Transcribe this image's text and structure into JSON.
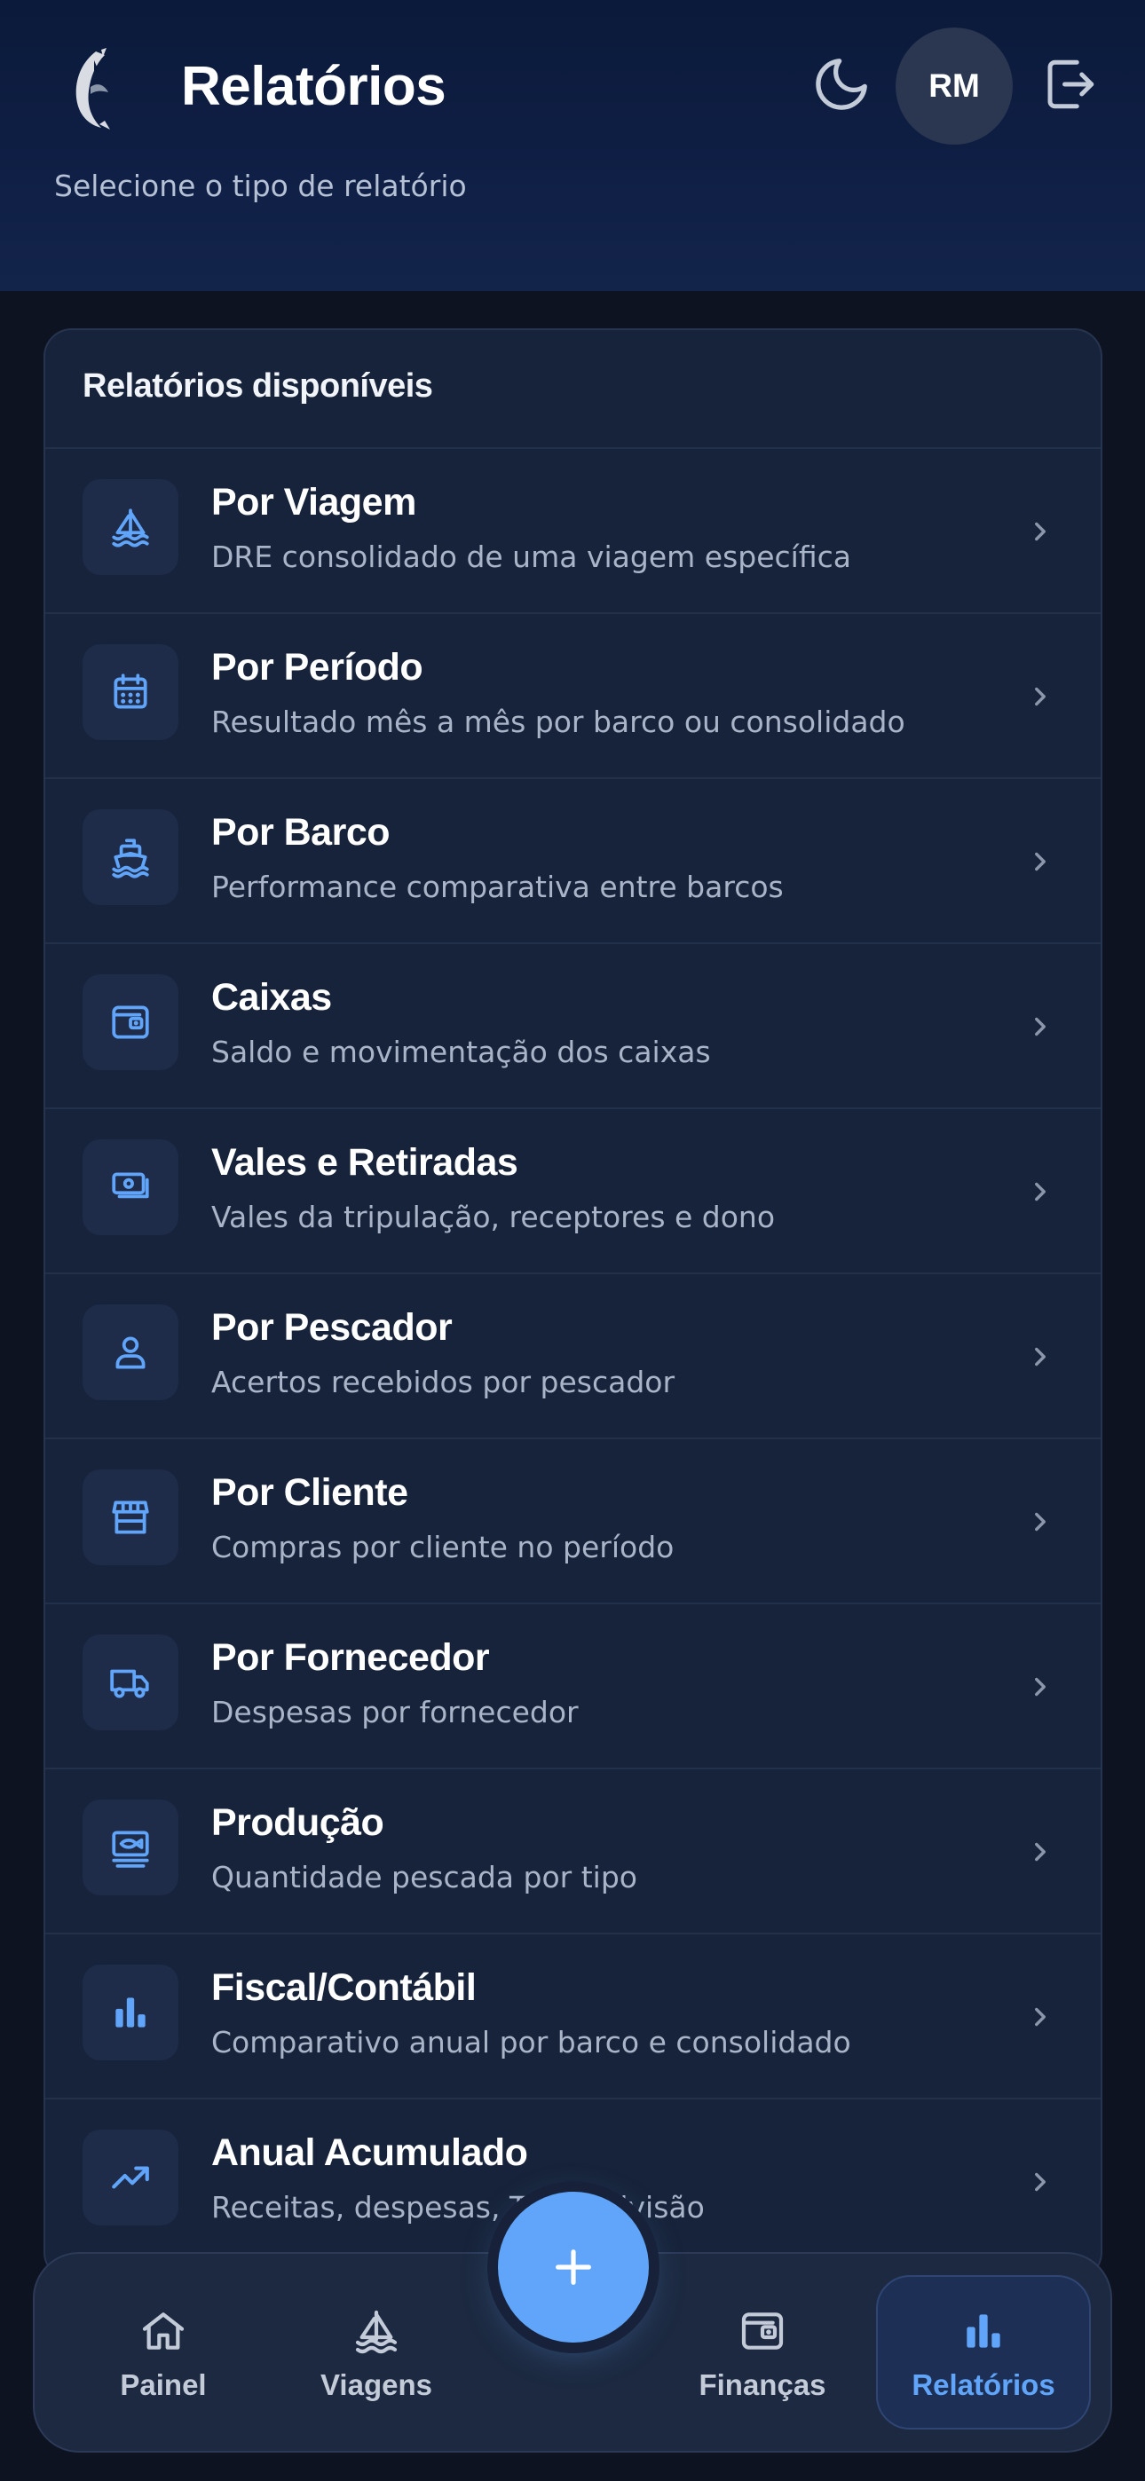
{
  "header": {
    "title": "Relatórios",
    "subtitle": "Selecione o tipo de relatório",
    "avatar_initials": "RM"
  },
  "card": {
    "title": "Relatórios disponíveis",
    "items": [
      {
        "title": "Por Viagem",
        "description": "DRE consolidado de uma viagem específica",
        "icon": "sailboat-icon"
      },
      {
        "title": "Por Período",
        "description": "Resultado mês a mês por barco ou consolidado",
        "icon": "calendar-icon"
      },
      {
        "title": "Por Barco",
        "description": "Performance comparativa entre barcos",
        "icon": "ship-icon"
      },
      {
        "title": "Caixas",
        "description": "Saldo e movimentação dos caixas",
        "icon": "wallet-icon"
      },
      {
        "title": "Vales e Retiradas",
        "description": "Vales da tripulação, receptores e dono",
        "icon": "banknotes-icon"
      },
      {
        "title": "Por Pescador",
        "description": "Acertos recebidos por pescador",
        "icon": "user-icon"
      },
      {
        "title": "Por Cliente",
        "description": "Compras por cliente no período",
        "icon": "store-icon"
      },
      {
        "title": "Por Fornecedor",
        "description": "Despesas por fornecedor",
        "icon": "truck-icon"
      },
      {
        "title": "Produção",
        "description": "Quantidade pescada por tipo",
        "icon": "fish-icon"
      },
      {
        "title": "Fiscal/Contábil",
        "description": "Comparativo anual por barco e consolidado",
        "icon": "bar-chart-icon"
      },
      {
        "title": "Anual Acumulado",
        "description": "Receitas, despesas, T     e divisão",
        "icon": "trending-up-icon"
      }
    ]
  },
  "nav": {
    "items": [
      {
        "label": "Painel",
        "icon": "home-icon"
      },
      {
        "label": "Viagens",
        "icon": "sailboat-icon"
      },
      {
        "label": "Finanças",
        "icon": "wallet-icon"
      },
      {
        "label": "Relatórios",
        "icon": "bar-chart-icon",
        "active": true
      }
    ],
    "fab_icon": "plus-icon"
  },
  "colors": {
    "accent": "#60a5fa",
    "header_bg": "#0f1f45",
    "card_bg": "#17233a",
    "icon_tile_bg": "#1e2b49"
  }
}
